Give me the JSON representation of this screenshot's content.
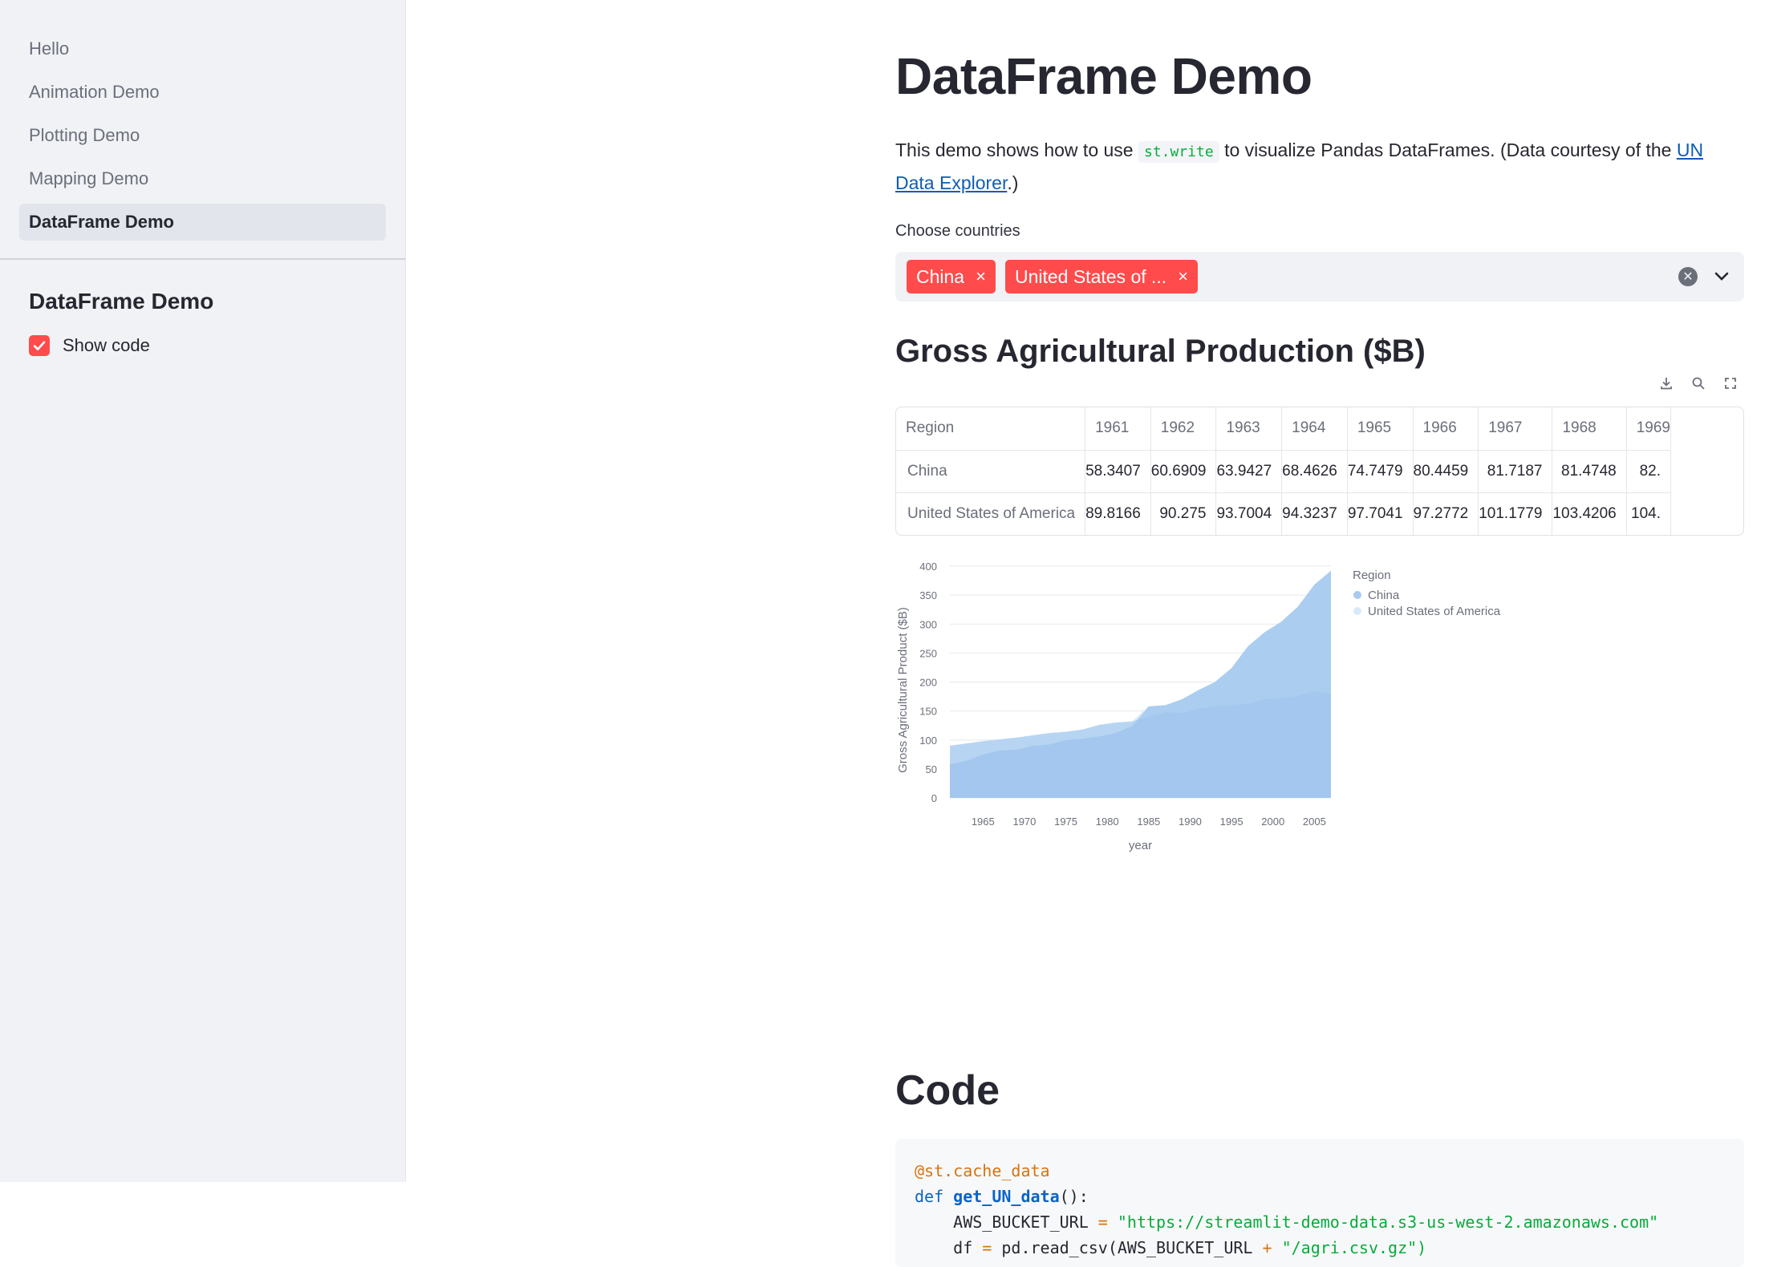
{
  "sidebar": {
    "nav": [
      "Hello",
      "Animation Demo",
      "Plotting Demo",
      "Mapping Demo",
      "DataFrame Demo"
    ],
    "active_index": 4,
    "section_title": "DataFrame Demo",
    "show_code_label": "Show code",
    "show_code_checked": true
  },
  "main": {
    "title": "DataFrame Demo",
    "intro_before": "This demo shows how to use ",
    "intro_code": "st.write",
    "intro_after": " to visualize Pandas DataFrames. (Data courtesy of the ",
    "intro_link": "UN Data Explorer",
    "intro_end": ".)",
    "countries_label": "Choose countries",
    "selected_countries": [
      "China",
      "United States of ..."
    ],
    "section_title": "Gross Agricultural Production ($B)",
    "code_title": "Code"
  },
  "table": {
    "columns": [
      "Region",
      "1961",
      "1962",
      "1963",
      "1964",
      "1965",
      "1966",
      "1967",
      "1968",
      "1969"
    ],
    "rows": [
      {
        "region": "China",
        "values": [
          "58.3407",
          "60.6909",
          "63.9427",
          "68.4626",
          "74.7479",
          "80.4459",
          "81.7187",
          "81.4748",
          "82."
        ]
      },
      {
        "region": "United States of America",
        "values": [
          "89.8166",
          "90.275",
          "93.7004",
          "94.3237",
          "97.7041",
          "97.2772",
          "101.1779",
          "103.4206",
          "104."
        ]
      }
    ]
  },
  "chart_data": {
    "type": "area",
    "stacked": true,
    "xlabel": "year",
    "ylabel": "Gross Agricultural Product ($B)",
    "ylim": [
      0,
      400
    ],
    "yticks": [
      0,
      50,
      100,
      150,
      200,
      250,
      300,
      350,
      400
    ],
    "xticks": [
      1965,
      1970,
      1975,
      1980,
      1985,
      1990,
      1995,
      2000,
      2005
    ],
    "xlim": [
      1961,
      2007
    ],
    "legend_title": "Region",
    "legend_position": "top-right",
    "grid": true,
    "series": [
      {
        "name": "China",
        "color": "#a8cbef",
        "x": [
          1961,
          1963,
          1965,
          1967,
          1969,
          1971,
          1973,
          1975,
          1977,
          1979,
          1981,
          1983,
          1985,
          1987,
          1989,
          1991,
          1993,
          1995,
          1997,
          1999,
          2001,
          2003,
          2005,
          2007
        ],
        "values": [
          58,
          64,
          75,
          82,
          83,
          90,
          92,
          100,
          102,
          106,
          112,
          124,
          158,
          160,
          170,
          186,
          200,
          224,
          262,
          286,
          304,
          330,
          368,
          392
        ]
      },
      {
        "name": "United States of America",
        "color": "#d8eafa",
        "x": [
          1961,
          1963,
          1965,
          1967,
          1969,
          1971,
          1973,
          1975,
          1977,
          1979,
          1981,
          1983,
          1985,
          1987,
          1989,
          1991,
          1993,
          1995,
          1997,
          1999,
          2001,
          2003,
          2005,
          2007
        ],
        "values": [
          90,
          94,
          98,
          101,
          104,
          108,
          112,
          114,
          118,
          126,
          130,
          132,
          140,
          148,
          146,
          154,
          158,
          160,
          162,
          170,
          172,
          176,
          184,
          180
        ]
      }
    ]
  },
  "code": [
    [
      {
        "t": "@st.cache_data",
        "c": "c-dec"
      }
    ],
    [
      {
        "t": "def ",
        "c": "c-kw"
      },
      {
        "t": "get_UN_data",
        "c": "c-fn"
      },
      {
        "t": "():",
        "c": ""
      }
    ],
    [
      {
        "t": "    AWS_BUCKET_URL ",
        "c": ""
      },
      {
        "t": "=",
        "c": "c-op"
      },
      {
        "t": " \"https://streamlit-demo-data.s3-us-west-2.amazonaws.com\"",
        "c": "c-str"
      }
    ],
    [
      {
        "t": "    df ",
        "c": ""
      },
      {
        "t": "=",
        "c": "c-op"
      },
      {
        "t": " pd.read_csv(AWS_BUCKET_URL ",
        "c": ""
      },
      {
        "t": "+",
        "c": "c-op"
      },
      {
        "t": " \"/agri.csv.gz\")",
        "c": "c-str"
      }
    ]
  ],
  "icons": {
    "download": "download-icon",
    "search": "search-icon",
    "fullscreen": "fullscreen-icon",
    "clear": "clear-icon",
    "chevron": "chevron-down-icon",
    "tag_close": "close-icon",
    "check": "check-icon"
  },
  "colors": {
    "accent": "#ff4b4b",
    "sidebar_bg": "#f0f2f6",
    "link": "#0d5db3"
  }
}
